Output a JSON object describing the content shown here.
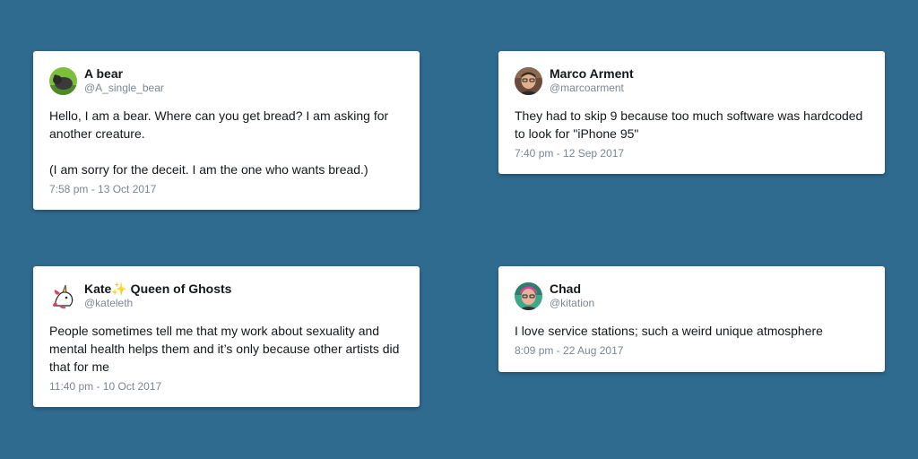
{
  "tweets": [
    {
      "name": "A bear",
      "handle": "@A_single_bear",
      "text": [
        "Hello, I am a bear. Where can you get bread? I am asking for another creature.",
        "(I am sorry for the deceit. I am the one who wants bread.)"
      ],
      "time": "7:58 pm - 13 Oct 2017",
      "avatar_icon": "bear-avatar"
    },
    {
      "name": "Marco Arment",
      "handle": "@marcoarment",
      "text": [
        "They had to skip 9 because too much software was hardcoded to look for \"iPhone 95\""
      ],
      "time": "7:40 pm - 12 Sep 2017",
      "avatar_icon": "person-avatar"
    },
    {
      "name_prefix": "Kate",
      "name_suffix": " Queen of Ghosts",
      "name_emoji": "sparkles-icon",
      "handle": "@kateleth",
      "text": [
        "People sometimes tell me that my work about sexuality and mental health helps them and it’s only because other artists did that for me"
      ],
      "time": "11:40 pm - 10 Oct 2017",
      "avatar_icon": "unicorn-avatar"
    },
    {
      "name": "Chad",
      "handle": "@kitation",
      "text": [
        "I love service stations; such a weird unique atmosphere"
      ],
      "time": "8:09 pm - 22 Aug 2017",
      "avatar_icon": "person-avatar"
    }
  ],
  "colors": {
    "background": "#2f6a8f",
    "card": "#ffffff",
    "text": "#14171a",
    "muted": "#7a8691"
  }
}
